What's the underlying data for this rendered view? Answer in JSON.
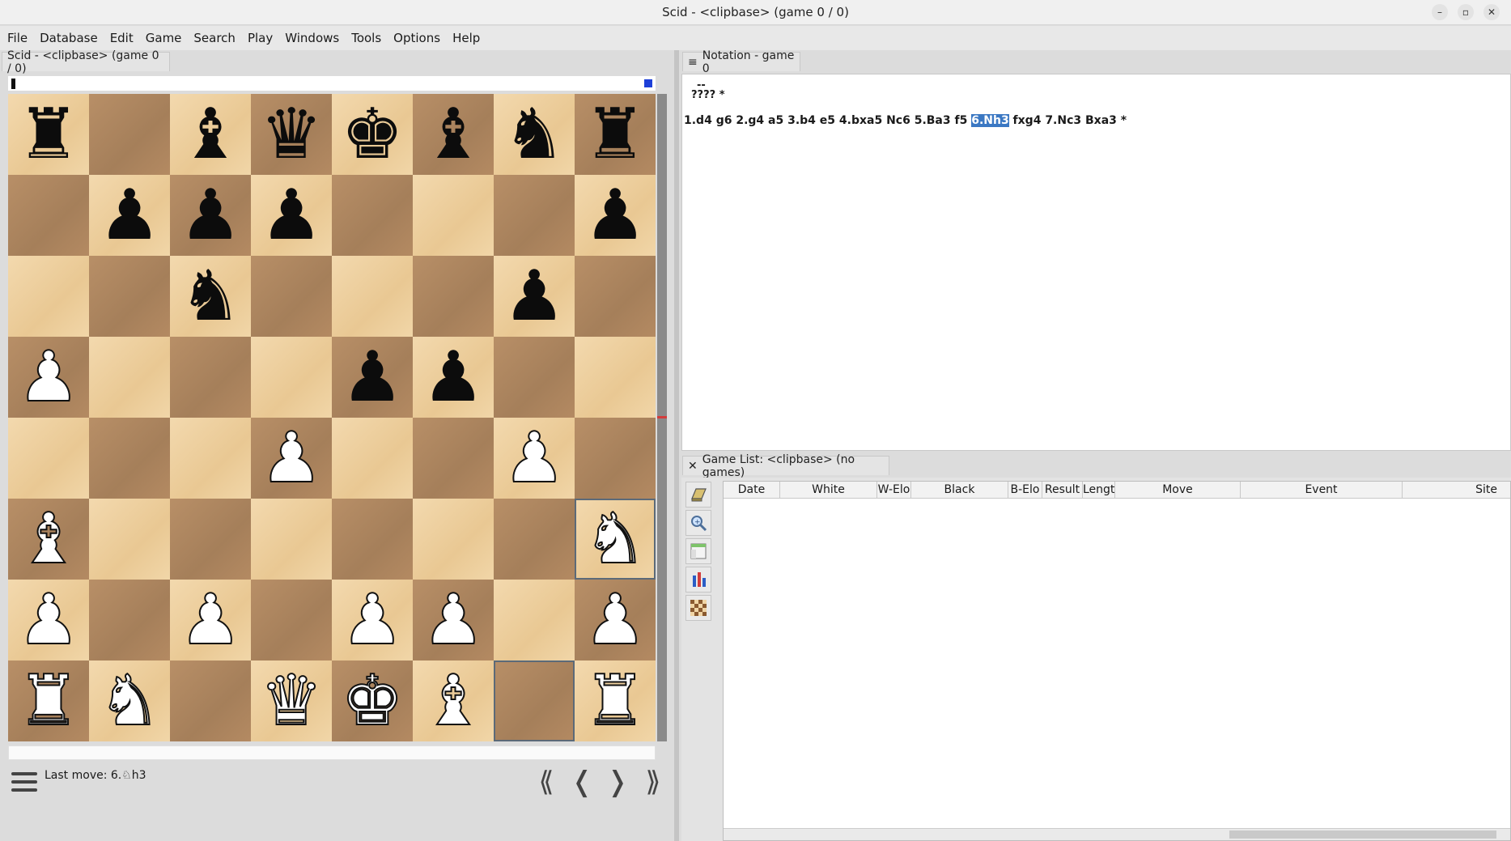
{
  "window": {
    "title": "Scid - <clipbase> (game 0 / 0)",
    "controls": [
      "–",
      "▫",
      "✕"
    ]
  },
  "menu": [
    "File",
    "Database",
    "Edit",
    "Game",
    "Search",
    "Play",
    "Windows",
    "Tools",
    "Options",
    "Help"
  ],
  "board_panel": {
    "tab_label": "Scid - <clipbase> (game 0 / 0)",
    "last_move": "Last move: 6.♘h3",
    "nav": [
      "⟪",
      "❬",
      "❭",
      "⟫"
    ],
    "position": [
      [
        "br",
        "",
        "bb",
        "bq",
        "bk",
        "bb",
        "bn",
        "br"
      ],
      [
        "",
        "bp",
        "bp",
        "bp",
        "",
        "",
        "",
        "bp"
      ],
      [
        "",
        "",
        "bn",
        "",
        "",
        "",
        "bp",
        ""
      ],
      [
        "wp",
        "",
        "",
        "",
        "bp",
        "bp",
        "",
        ""
      ],
      [
        "",
        "",
        "",
        "wp",
        "",
        "",
        "wp",
        ""
      ],
      [
        "wb",
        "",
        "",
        "",
        "",
        "",
        "",
        "wn"
      ],
      [
        "wp",
        "",
        "wp",
        "",
        "wp",
        "wp",
        "",
        "wp"
      ],
      [
        "wr",
        "wn",
        "",
        "wq",
        "wk",
        "wb",
        "",
        "wr"
      ]
    ],
    "highlight_squares": [
      "h3",
      "g1"
    ]
  },
  "notation": {
    "tab_label": "Notation - game 0",
    "header_line1": "--",
    "header_line2": "????  *",
    "moves_before": "1.d4 g6 2.g4 a5 3.b4 e5 4.bxa5 Nc6 5.Ba3 f5 ",
    "current_move": "6.Nh3",
    "moves_after": " fxg4 7.Nc3 Bxa3 *"
  },
  "game_list": {
    "tab_label": "Game List: <clipbase> (no games)",
    "close_glyph": "✕",
    "columns": [
      "Date",
      "White",
      "W-Elo",
      "Black",
      "B-Elo",
      "Result",
      "Lengt",
      "Move",
      "Event",
      "Site"
    ],
    "tools": [
      "book-icon",
      "zoom-icon",
      "layout-icon",
      "chart-icon",
      "board-icon"
    ]
  }
}
